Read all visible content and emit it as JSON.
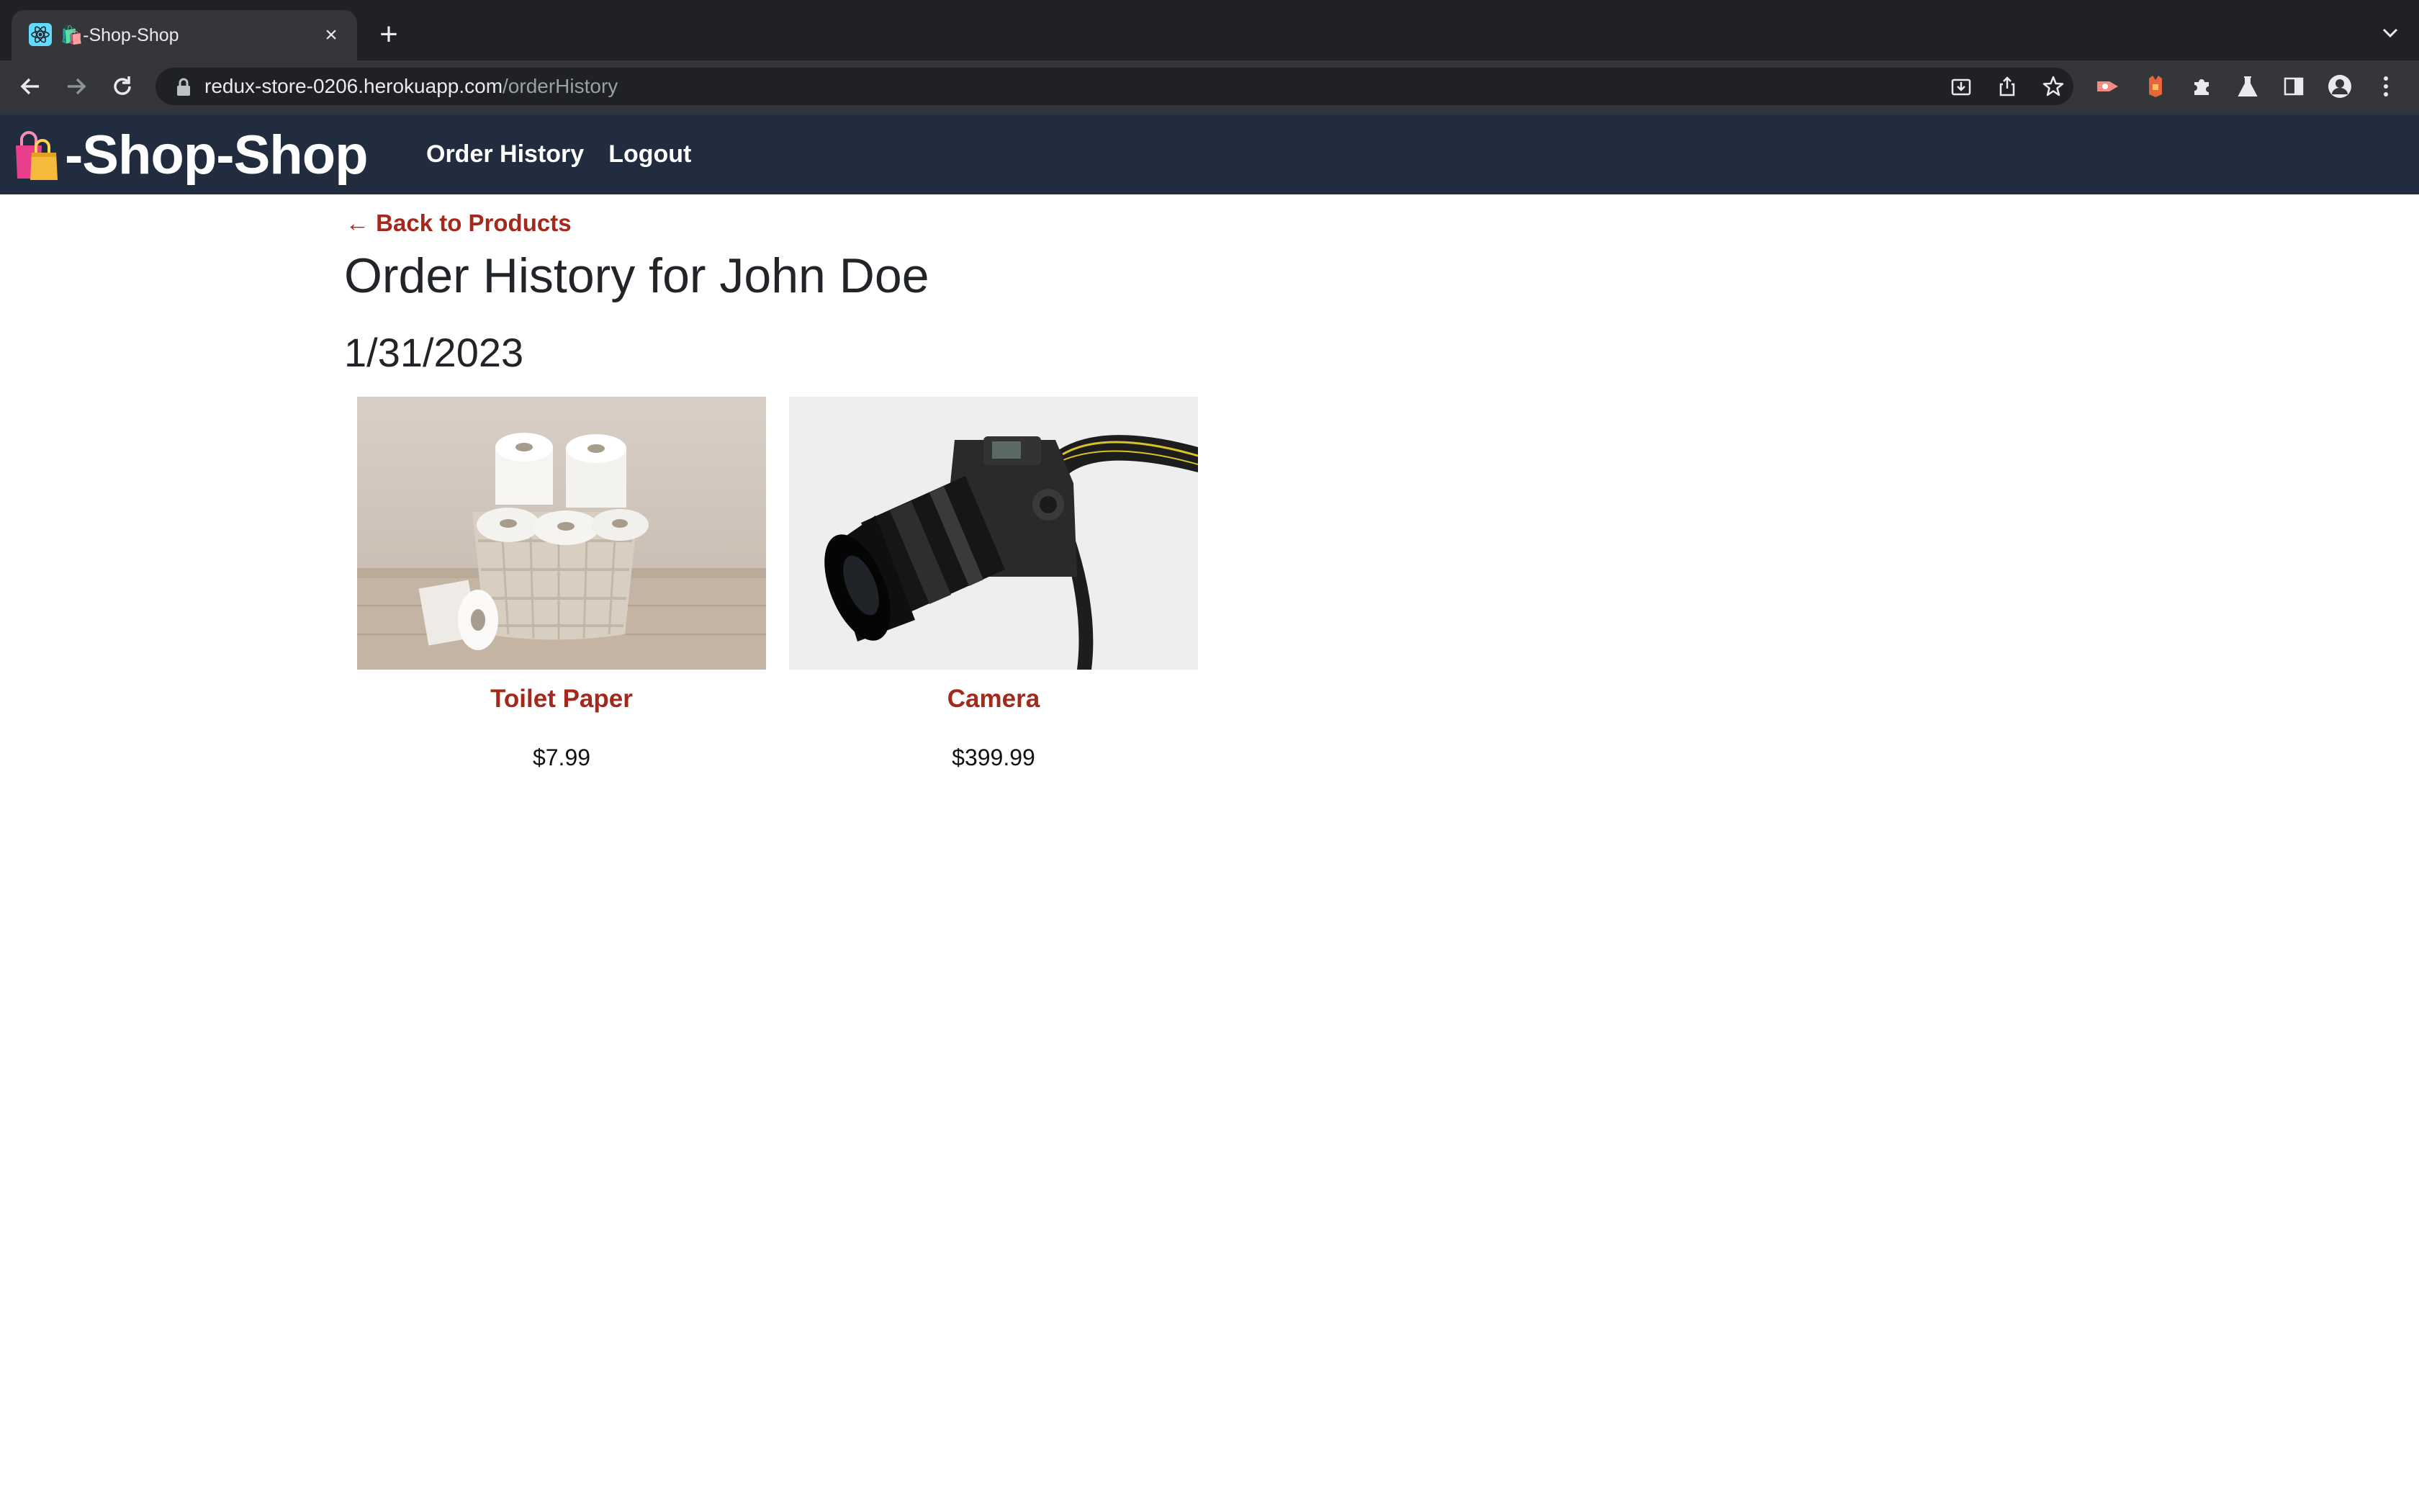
{
  "browser": {
    "tab": {
      "title": "🛍️-Shop-Shop",
      "favicon": "react-icon"
    },
    "url": {
      "host": "redux-store-0206.herokuapp.com",
      "path": "/orderHistory"
    }
  },
  "header": {
    "brand_emoji": "shopping-bags-icon",
    "brand_text": "-Shop-Shop",
    "nav": {
      "order_history": "Order History",
      "logout": "Logout"
    }
  },
  "main": {
    "back_link": "← Back to Products",
    "title": "Order History for John Doe",
    "orders": [
      {
        "date": "1/31/2023",
        "products": [
          {
            "name": "Toilet Paper",
            "price": "$7.99",
            "image": "toilet-paper-basket"
          },
          {
            "name": "Camera",
            "price": "$399.99",
            "image": "dslr-camera"
          }
        ]
      }
    ]
  },
  "colors": {
    "header_bg": "#212d3f",
    "link_red": "#a4281b",
    "chrome_dark": "#202124",
    "chrome_toolbar": "#35363a"
  }
}
